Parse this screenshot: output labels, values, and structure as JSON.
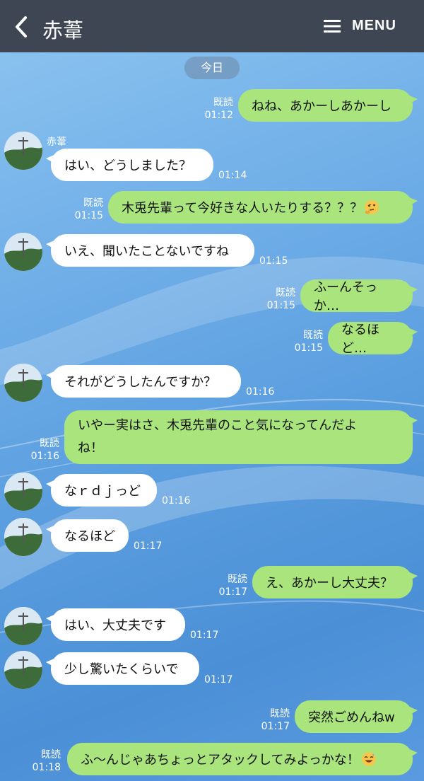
{
  "header": {
    "title": "赤葦",
    "menu_label": "MENU"
  },
  "date_label": "今日",
  "sender_name": "赤葦",
  "read_label": "既読",
  "messages": [
    {
      "dir": "out",
      "text": "ねね、あかーしあかーし",
      "time": "01:12",
      "read": true
    },
    {
      "dir": "in",
      "text": "はい、どうしました？",
      "time": "01:14"
    },
    {
      "dir": "out",
      "text": "木兎先輩って今好きな人いたりする？？？",
      "emoji": "thinking-face-emoji",
      "time": "01:15",
      "read": true
    },
    {
      "dir": "in",
      "text": "いえ、聞いたことないですね",
      "time": "01:15"
    },
    {
      "dir": "out",
      "text": "ふーんそっか…",
      "time": "01:15",
      "read": true
    },
    {
      "dir": "out",
      "text": "なるほど…",
      "time": "01:15",
      "read": true
    },
    {
      "dir": "in",
      "text": "それがどうしたんですか？",
      "time": "01:16"
    },
    {
      "dir": "out",
      "lines": [
        "いやー実はさ、木兎先輩のこと気になってんだよ",
        "ね！"
      ],
      "time": "01:16",
      "read": true
    },
    {
      "dir": "in",
      "text": "なｒｄｊっど",
      "time": "01:16"
    },
    {
      "dir": "in",
      "text": "なるほど",
      "time": "01:17"
    },
    {
      "dir": "out",
      "text": "え、あかーし大丈夫？",
      "time": "01:17",
      "read": true
    },
    {
      "dir": "in",
      "text": "はい、大丈夫です",
      "time": "01:17"
    },
    {
      "dir": "in",
      "text": "少し驚いたくらいで",
      "time": "01:17"
    },
    {
      "dir": "out",
      "text": "突然ごめんねw",
      "time": "01:17",
      "read": true
    },
    {
      "dir": "out",
      "text": "ふ〜んじゃあちょっとアタックしてみよっかな！",
      "emoji": "grinning-sweat-emoji",
      "time": "01:18",
      "read": true
    }
  ]
}
